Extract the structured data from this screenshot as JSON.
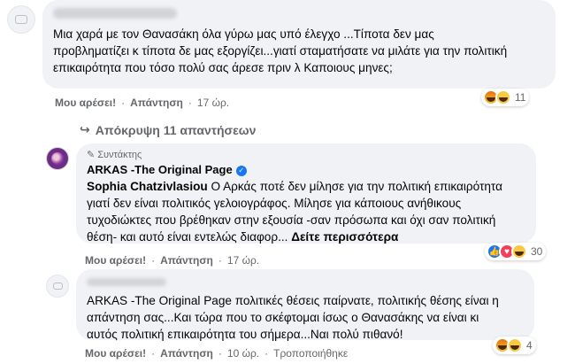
{
  "comments": [
    {
      "text": "Μια χαρά με τον Θανασάκη όλα γύρω μας υπό έλεγχο ...Τίποτα δεν μας προβληματίζει κ τίποτα δε μας εξοργίζει...γιατί σταματήσατε να μιλάτε για την πολιτική επικαιρότητα που τόσο πολύ σας άρεσε πριν λ Καποιους μηνες;",
      "like_label": "Μου αρέσει!",
      "reply_label": "Απάντηση",
      "time": "17 ώρ.",
      "reaction_count": "11",
      "reactions": [
        "angry-icon",
        "haha-icon"
      ]
    }
  ],
  "hide_replies_label": "Απόκρυψη 11 απαντήσεων",
  "reply1": {
    "badge": "Συντάκτης",
    "author": "ARKAS -The Original Page",
    "mention": "Sophia Chatzivlasiou",
    "text": " Ο Αρκάς ποτέ δεν μίλησε για την πολιτική επικαιρότητα γιατί δεν είναι πολιτικός γελοιογράφος. Μίλησε για κάποιους ανήθικους τυχοδιώκτες που βρέθηκαν στην εξουσία -σαν πρόσωπα και όχι σαν πολιτική θέση- και αυτό είναι εντελώς διαφορ... ",
    "see_more": "Δείτε περισσότερα",
    "like_label": "Μου αρέσει!",
    "reply_label": "Απάντηση",
    "time": "17 ώρ.",
    "reaction_count": "30",
    "reactions": [
      "like-icon",
      "love-icon",
      "haha-icon"
    ]
  },
  "reply2": {
    "text": "ARKAS -The Original Page πολιτικές θέσεις παίρνατε, πολιτικής θέσης είναι η απάντηση σας...Και τώρα που το σκέφτομαι ίσως ο Θανασάκης να είναι κι αυτός πολιτική επικαιρότητα του σήμερα...Ναι πολύ πιθανό!",
    "like_label": "Μου αρέσει!",
    "reply_label": "Απάντηση",
    "time": "10 ώρ.",
    "edited": "Τροποποιήθηκε",
    "reaction_count": "4",
    "reactions": [
      "angry-icon",
      "haha-icon"
    ]
  },
  "colors": {
    "accent": "#1877f2",
    "bubble": "#f0f2f5",
    "meta": "#65676b"
  }
}
